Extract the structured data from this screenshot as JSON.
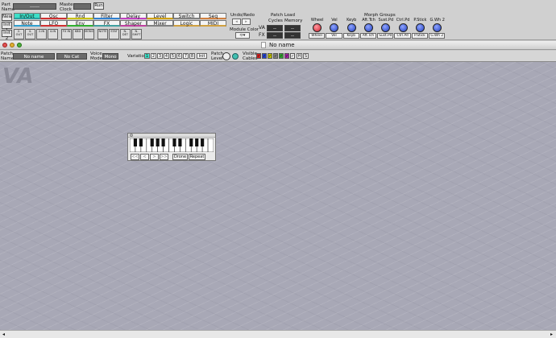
{
  "colors": {
    "canvas": "#a8a8b6",
    "accent": "#3ce0c8",
    "knob": "#2040c0"
  },
  "header": {
    "part_label": "Part\nName",
    "part_value": "------",
    "master_clock_label": "Master\nClock",
    "master_clock_value": "",
    "run_label": "Run",
    "new_label": "New",
    "init1_label": "Init 1",
    "init2_label": "Init 2"
  },
  "module_tabs": [
    [
      {
        "label": "In/Out",
        "color": "#3ce0c8",
        "bar": "#2aa0a0"
      },
      {
        "label": "Osc",
        "color": "#f4f4f4",
        "bar": "#d03030"
      },
      {
        "label": "Rnd",
        "color": "#f4f4f4",
        "bar": "#c8c000"
      },
      {
        "label": "Filter",
        "color": "#f4f4f4",
        "bar": "#3080d0"
      },
      {
        "label": "Delay",
        "color": "#f4f4f4",
        "bar": "#c040c0"
      },
      {
        "label": "Level",
        "color": "#f4f4f4",
        "bar": "#d0a000"
      },
      {
        "label": "Switch",
        "color": "#f4f4f4",
        "bar": "#808080"
      },
      {
        "label": "Seq",
        "color": "#f4f4f4",
        "bar": "#d08040"
      }
    ],
    [
      {
        "label": "Note",
        "color": "#f4f4f4",
        "bar": "#30a0d0"
      },
      {
        "label": "LFO",
        "color": "#f4f4f4",
        "bar": "#d03030"
      },
      {
        "label": "Env",
        "color": "#f4f4f4",
        "bar": "#30b030"
      },
      {
        "label": "FX",
        "color": "#f4f4f4",
        "bar": "#40a0a0"
      },
      {
        "label": "Shaper",
        "color": "#f4f4f4",
        "bar": "#c040a0"
      },
      {
        "label": "Mixer",
        "color": "#f4f4f4",
        "bar": "#808080"
      },
      {
        "label": "Logic",
        "color": "#f4f4f4",
        "bar": "#d0a040"
      },
      {
        "label": "MIDI",
        "color": "#f4f4f4",
        "bar": "#d0a040"
      }
    ]
  ],
  "module_buttons": [
    "2-OUT",
    "4-OUT",
    "2-IN",
    "4-IN",
    "FX IN",
    "KBD",
    "MONO",
    "NOTE",
    "STAT",
    "N-DET",
    "N-SHIFT"
  ],
  "undo_redo_label": "Undo/Redo",
  "module_color_label": "Module Color",
  "patch_load": {
    "title": "Patch Load",
    "cycles_label": "Cycles",
    "memory_label": "Memory",
    "va_label": "VA",
    "fx_label": "FX",
    "va_cycles": "--",
    "va_memory": "--",
    "fx_cycles": "--",
    "fx_memory": "--"
  },
  "morph": {
    "title": "Morph Groups",
    "knobs": [
      "Wheel",
      "Vel",
      "Keyb",
      "Aft.Tch",
      "Sust.Pd",
      "Ctrl.Pd",
      "P.Stick",
      "G.Wh 2"
    ],
    "assign": [
      "Wheel",
      "Vel",
      "Keyb",
      "Aft.Tch",
      "Sust.Pd",
      "Ctrl.Pd",
      "P.Stick",
      "G.Wh 2"
    ]
  },
  "window": {
    "title": "No name"
  },
  "patchbar": {
    "patch_name_label": "Patch\nName",
    "patch_name": "No name",
    "category": "No Cat",
    "voice_mode_label": "Voice\nMode",
    "voice_mode": "Mono",
    "variation_label": "Variation",
    "variations": [
      "1",
      "2",
      "3",
      "4",
      "5",
      "6",
      "7",
      "8"
    ],
    "init_label": "Init",
    "patch_level_label": "Patch\nLevel",
    "visible_cables_label": "Visible\nCables",
    "cable_colors": [
      "#d02020",
      "#2040d0",
      "#c0c000",
      "#808080",
      "#30a030",
      "#a020a0",
      "#f0f0f0"
    ],
    "h_label": "H",
    "s_label": "S"
  },
  "canvas": {
    "section_label": "VA"
  },
  "keyboard_module": {
    "nav": [
      "<<",
      "<",
      ">",
      ">>"
    ],
    "drone_label": "Drone",
    "repeat_label": "Repeat"
  }
}
